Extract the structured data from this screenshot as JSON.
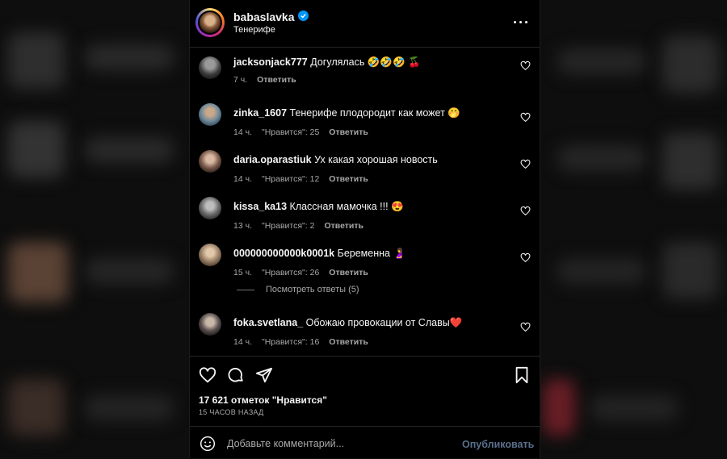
{
  "header": {
    "username": "babaslavka",
    "location": "Тенерифе"
  },
  "comments": [
    {
      "user": "jacksonjack777",
      "text": "Догулялась 🤣🤣🤣 🍒",
      "time": "7 ч.",
      "likes": "",
      "reply": "Ответить"
    },
    {
      "user": "zinka_1607",
      "text": "Тенерифе плодородит как может 🤭",
      "time": "14 ч.",
      "likes": "\"Нравится\": 25",
      "reply": "Ответить"
    },
    {
      "user": "daria.oparastiuk",
      "text": "Ух какая хорошая новость",
      "time": "14 ч.",
      "likes": "\"Нравится\": 12",
      "reply": "Ответить"
    },
    {
      "user": "kissa_ka13",
      "text": "Классная мамочка !!! 😍",
      "time": "13 ч.",
      "likes": "\"Нравится\": 2",
      "reply": "Ответить"
    },
    {
      "user": "000000000000k0001k",
      "text": "Беременна 🤰",
      "time": "15 ч.",
      "likes": "\"Нравится\": 26",
      "reply": "Ответить"
    },
    {
      "user": "foka.svetlana_",
      "text": "Обожаю провокации от Славы❤️",
      "time": "14 ч.",
      "likes": "\"Нравится\": 16",
      "reply": "Ответить"
    }
  ],
  "view_replies": "Посмотреть ответы (5)",
  "likes_count": "17 621 отметок \"Нравится\"",
  "posted_time": "15 ЧАСОВ НАЗАД",
  "composer": {
    "placeholder": "Добавьте комментарий...",
    "publish": "Опубликовать"
  },
  "colors": {
    "verified": "#0095f6",
    "publish": "#5a6f8c",
    "muted": "#a8a8a8"
  }
}
